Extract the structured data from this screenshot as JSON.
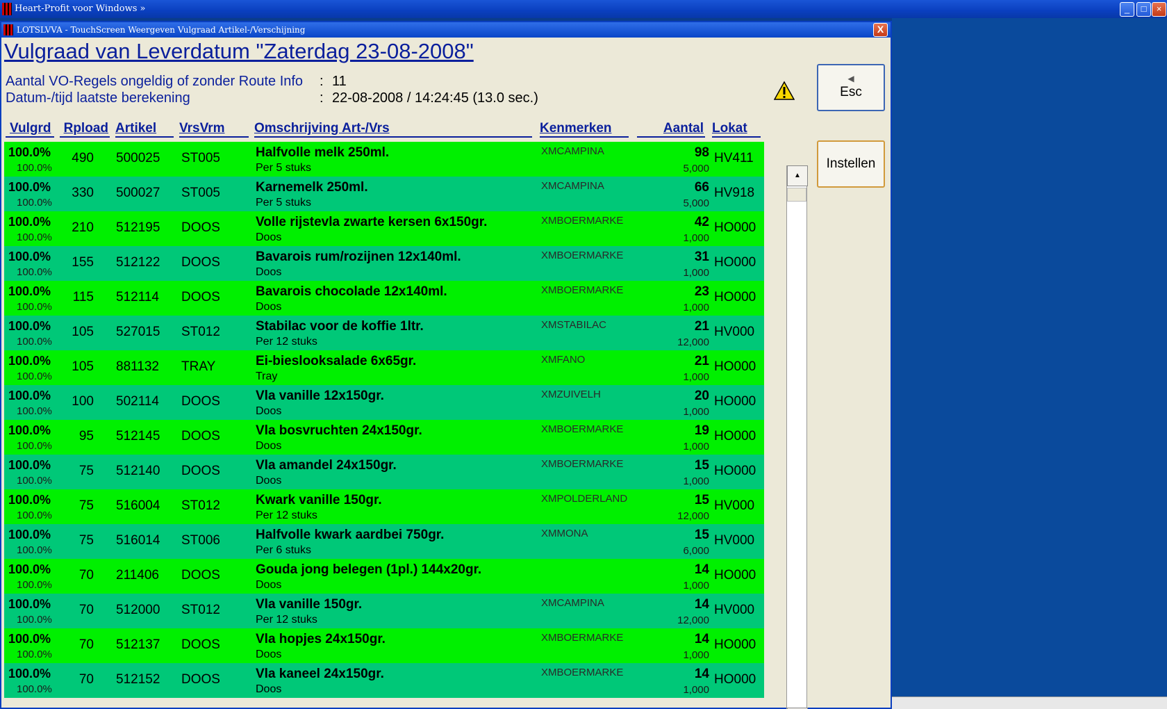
{
  "app": {
    "title": "Heart-Profit voor Windows  »"
  },
  "window": {
    "title": "LOTSLVVA - TouchScreen Weergeven Vulgraad Artikel-/Verschijning",
    "close": "X"
  },
  "heading": "Vulgraad van Leverdatum \"Zaterdag 23-08-2008\"",
  "info": [
    {
      "label": "Aantal VO-Regels ongeldig of zonder Route Info",
      "colon": ":",
      "value": "11"
    },
    {
      "label": "Datum-/tijd laatste berekening",
      "colon": ":",
      "value": "22-08-2008 / 14:24:45 (13.0 sec.)"
    }
  ],
  "columns": {
    "vulgrd": "Vulgrd",
    "rpload": "Rpload",
    "artikel": "Artikel",
    "vrsvrm": "VrsVrm",
    "omschrijving": "Omschrijving Art-/Vrs",
    "kenmerken": "Kenmerken",
    "aantal": "Aantal",
    "lokat": "Lokat"
  },
  "rows": [
    {
      "vulgrd": "100.0%",
      "vulgrd2": "100.0%",
      "rpload": "490",
      "artikel": "500025",
      "vrsvrm": "ST005",
      "oms": "Halfvolle melk 250ml.",
      "oms2": "Per 5 stuks",
      "ken": "XMCAMPINA",
      "aantal": "98",
      "aantal2": "5,000",
      "lokat": "HV411"
    },
    {
      "vulgrd": "100.0%",
      "vulgrd2": "100.0%",
      "rpload": "330",
      "artikel": "500027",
      "vrsvrm": "ST005",
      "oms": "Karnemelk 250ml.",
      "oms2": "Per 5 stuks",
      "ken": "XMCAMPINA",
      "aantal": "66",
      "aantal2": "5,000",
      "lokat": "HV918"
    },
    {
      "vulgrd": "100.0%",
      "vulgrd2": "100.0%",
      "rpload": "210",
      "artikel": "512195",
      "vrsvrm": "DOOS",
      "oms": "Volle rijstevla zwarte kersen 6x150gr.",
      "oms2": "Doos",
      "ken": "XMBOERMARKE",
      "aantal": "42",
      "aantal2": "1,000",
      "lokat": "HO000"
    },
    {
      "vulgrd": "100.0%",
      "vulgrd2": "100.0%",
      "rpload": "155",
      "artikel": "512122",
      "vrsvrm": "DOOS",
      "oms": "Bavarois rum/rozijnen 12x140ml.",
      "oms2": "Doos",
      "ken": "XMBOERMARKE",
      "aantal": "31",
      "aantal2": "1,000",
      "lokat": "HO000"
    },
    {
      "vulgrd": "100.0%",
      "vulgrd2": "100.0%",
      "rpload": "115",
      "artikel": "512114",
      "vrsvrm": "DOOS",
      "oms": "Bavarois chocolade 12x140ml.",
      "oms2": "Doos",
      "ken": "XMBOERMARKE",
      "aantal": "23",
      "aantal2": "1,000",
      "lokat": "HO000"
    },
    {
      "vulgrd": "100.0%",
      "vulgrd2": "100.0%",
      "rpload": "105",
      "artikel": "527015",
      "vrsvrm": "ST012",
      "oms": "Stabilac voor de koffie 1ltr.",
      "oms2": "Per 12 stuks",
      "ken": "XMSTABILAC",
      "aantal": "21",
      "aantal2": "12,000",
      "lokat": "HV000"
    },
    {
      "vulgrd": "100.0%",
      "vulgrd2": "100.0%",
      "rpload": "105",
      "artikel": "881132",
      "vrsvrm": "TRAY",
      "oms": "Ei-bieslooksalade 6x65gr.",
      "oms2": "Tray",
      "ken": "XMFANO",
      "aantal": "21",
      "aantal2": "1,000",
      "lokat": "HO000"
    },
    {
      "vulgrd": "100.0%",
      "vulgrd2": "100.0%",
      "rpload": "100",
      "artikel": "502114",
      "vrsvrm": "DOOS",
      "oms": "Vla vanille 12x150gr.",
      "oms2": "Doos",
      "ken": "XMZUIVELH",
      "aantal": "20",
      "aantal2": "1,000",
      "lokat": "HO000"
    },
    {
      "vulgrd": "100.0%",
      "vulgrd2": "100.0%",
      "rpload": "95",
      "artikel": "512145",
      "vrsvrm": "DOOS",
      "oms": "Vla bosvruchten 24x150gr.",
      "oms2": "Doos",
      "ken": "XMBOERMARKE",
      "aantal": "19",
      "aantal2": "1,000",
      "lokat": "HO000"
    },
    {
      "vulgrd": "100.0%",
      "vulgrd2": "100.0%",
      "rpload": "75",
      "artikel": "512140",
      "vrsvrm": "DOOS",
      "oms": "Vla amandel 24x150gr.",
      "oms2": "Doos",
      "ken": "XMBOERMARKE",
      "aantal": "15",
      "aantal2": "1,000",
      "lokat": "HO000"
    },
    {
      "vulgrd": "100.0%",
      "vulgrd2": "100.0%",
      "rpload": "75",
      "artikel": "516004",
      "vrsvrm": "ST012",
      "oms": "Kwark vanille 150gr.",
      "oms2": "Per 12 stuks",
      "ken": "XMPOLDERLAND",
      "aantal": "15",
      "aantal2": "12,000",
      "lokat": "HV000"
    },
    {
      "vulgrd": "100.0%",
      "vulgrd2": "100.0%",
      "rpload": "75",
      "artikel": "516014",
      "vrsvrm": "ST006",
      "oms": "Halfvolle kwark aardbei 750gr.",
      "oms2": "Per 6 stuks",
      "ken": "XMMONA",
      "aantal": "15",
      "aantal2": "6,000",
      "lokat": "HV000"
    },
    {
      "vulgrd": "100.0%",
      "vulgrd2": "100.0%",
      "rpload": "70",
      "artikel": "211406",
      "vrsvrm": "DOOS",
      "oms": "Gouda jong belegen (1pl.) 144x20gr.",
      "oms2": "Doos",
      "ken": "",
      "aantal": "14",
      "aantal2": "1,000",
      "lokat": "HO000"
    },
    {
      "vulgrd": "100.0%",
      "vulgrd2": "100.0%",
      "rpload": "70",
      "artikel": "512000",
      "vrsvrm": "ST012",
      "oms": "Vla vanille 150gr.",
      "oms2": "Per 12 stuks",
      "ken": "XMCAMPINA",
      "aantal": "14",
      "aantal2": "12,000",
      "lokat": "HV000"
    },
    {
      "vulgrd": "100.0%",
      "vulgrd2": "100.0%",
      "rpload": "70",
      "artikel": "512137",
      "vrsvrm": "DOOS",
      "oms": "Vla hopjes 24x150gr.",
      "oms2": "Doos",
      "ken": "XMBOERMARKE",
      "aantal": "14",
      "aantal2": "1,000",
      "lokat": "HO000"
    },
    {
      "vulgrd": "100.0%",
      "vulgrd2": "100.0%",
      "rpload": "70",
      "artikel": "512152",
      "vrsvrm": "DOOS",
      "oms": "Vla kaneel 24x150gr.",
      "oms2": "Doos",
      "ken": "XMBOERMARKE",
      "aantal": "14",
      "aantal2": "1,000",
      "lokat": "HO000"
    }
  ],
  "buttons": {
    "esc": "Esc",
    "instellen": "Instellen"
  },
  "icons": {
    "warning": "warning-icon",
    "esc": "back-arrow-icon",
    "scroll_up": "arrow-up-icon",
    "scroll_down": "arrow-down-icon"
  },
  "colors": {
    "row_a": "#00f000",
    "row_b": "#00c878",
    "heading": "#0a1f9c"
  }
}
